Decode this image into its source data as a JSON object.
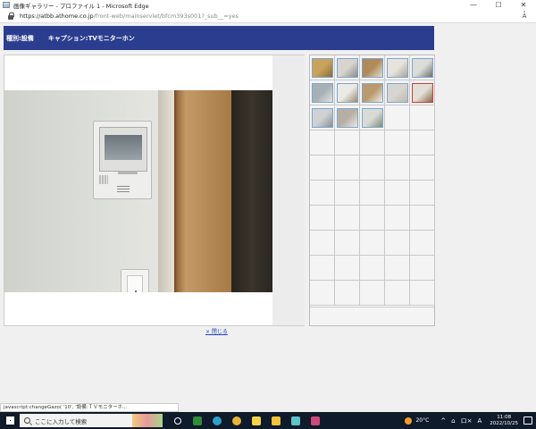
{
  "window": {
    "title": "画像ギャラリー - プロファイル 1 - Microsoft Edge",
    "controls": {
      "minimize": "—",
      "maximize": "☐",
      "close": "✕"
    }
  },
  "address_bar": {
    "url_host": "https://atbb.athome.co.jp",
    "url_rest": "/front-web/mainservlet/bfcm393s001?_sub__=yes",
    "read_aloud": "A͒"
  },
  "header": {
    "category": "種別:設備",
    "caption": "キャプション:TVモニターホン"
  },
  "main_photo": {
    "icon": "intercom-photo"
  },
  "close_link": "× 閉じる",
  "thumbnails": {
    "items": [
      {
        "name": "thumb-1",
        "colors": [
          "#c9a35c",
          "#8a6a3a"
        ]
      },
      {
        "name": "thumb-2",
        "colors": [
          "#d8d5cf",
          "#8c8a86"
        ]
      },
      {
        "name": "thumb-3",
        "colors": [
          "#b08a5a",
          "#e3ddd2"
        ]
      },
      {
        "name": "thumb-4",
        "colors": [
          "#e6e2dc",
          "#a8a49d"
        ]
      },
      {
        "name": "thumb-5",
        "colors": [
          "#dcdcd8",
          "#6f6f6c"
        ]
      },
      {
        "name": "thumb-6",
        "colors": [
          "#a7b0b6",
          "#e2e2e0"
        ]
      },
      {
        "name": "thumb-7",
        "colors": [
          "#eceae5",
          "#9a8a70"
        ]
      },
      {
        "name": "thumb-8",
        "colors": [
          "#b89a6e",
          "#efeee9"
        ]
      },
      {
        "name": "thumb-9",
        "colors": [
          "#d7d5d0",
          "#bfb9ad"
        ]
      },
      {
        "name": "thumb-10",
        "colors": [
          "#e2dfd8",
          "#8d6a45"
        ],
        "active": true
      },
      {
        "name": "thumb-11",
        "colors": [
          "#cfd2d4",
          "#8c8f92"
        ]
      },
      {
        "name": "thumb-12",
        "colors": [
          "#b6b0a4",
          "#ebe9e4"
        ]
      },
      {
        "name": "thumb-13",
        "colors": [
          "#d9dcd6",
          "#7f8a78"
        ]
      }
    ]
  },
  "status_bar": {
    "text": "javascript:changeGazo(                  '10',                  '設備:ＴＶモニターホ..."
  },
  "taskbar": {
    "search_placeholder": "ここに入力して検索",
    "weather_temp": "20°C",
    "tray_symbols": [
      "^",
      "⌂",
      "ロ×",
      "A"
    ],
    "time": "11:08",
    "date": "2022/10/25",
    "app_icons": [
      {
        "name": "task-view-icon",
        "color": "#ffffff"
      },
      {
        "name": "app-green-icon",
        "color": "#2e8b3a"
      },
      {
        "name": "edge-icon",
        "color": "#2aa3c8"
      },
      {
        "name": "chrome-icon",
        "color": "#e8b23a"
      },
      {
        "name": "sticky-note-icon",
        "color": "#f4d34a"
      },
      {
        "name": "file-explorer-icon",
        "color": "#f2c23a"
      },
      {
        "name": "book-icon",
        "color": "#5fc2c9"
      },
      {
        "name": "network-app-icon",
        "color": "#cc4a7a"
      }
    ]
  }
}
